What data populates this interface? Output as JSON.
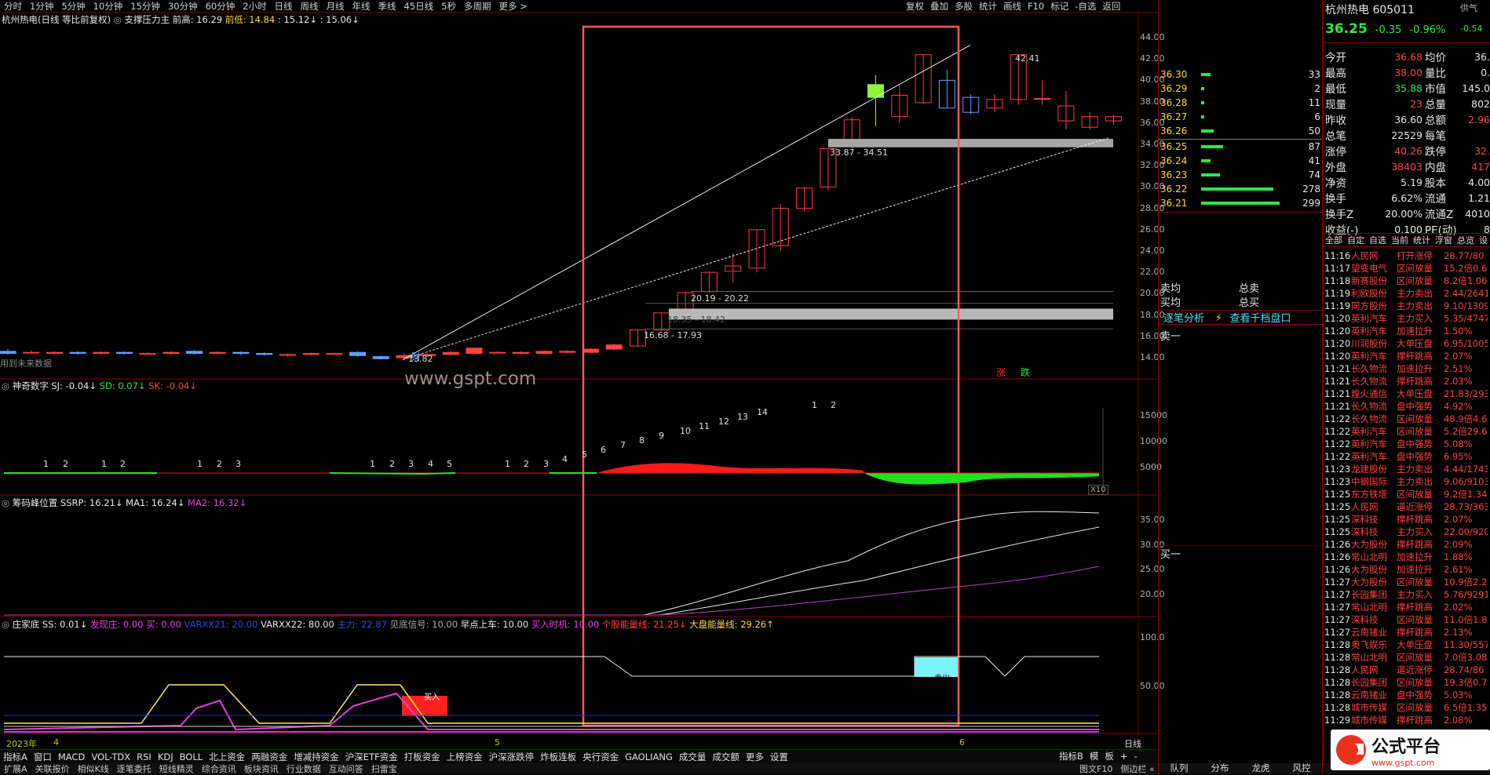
{
  "periods": [
    "分时",
    "1分钟",
    "5分钟",
    "10分钟",
    "15分钟",
    "30分钟",
    "60分钟",
    "2小时",
    "日线",
    "周线",
    "月线",
    "年线",
    "季线",
    "45日线",
    "5秒",
    "多周期",
    "更多 >"
  ],
  "tools": [
    "复权",
    "叠加",
    "多股",
    "统计",
    "画线",
    "F10",
    "标记",
    "-自选",
    "返回"
  ],
  "main_title": {
    "name": "杭州热电(日线 等比前复权)",
    "indicator": "支撑压力主",
    "pre_high_label": "前高: 16.29",
    "pre_low_label": "前低: 14.84",
    "v3": ": 15.12↓",
    "v4": ": 15.06↓"
  },
  "no_data": "用到未来数据",
  "price_axis": [
    "44.00",
    "42.00",
    "40.00",
    "38.00",
    "36.00",
    "34.00",
    "32.00",
    "30.00",
    "28.00",
    "26.00",
    "24.00",
    "22.00",
    "20.00",
    "18.00",
    "16.00",
    "14.00"
  ],
  "annotations": {
    "low": "13.82",
    "high": "42.41",
    "z1": "33.87 - 34.51",
    "z2": "20.19 - 20.22",
    "z3": "18.35 - 18.42",
    "z4": "16.68 - 17.93",
    "cai": "财",
    "zhang": "涨",
    "die": "跌"
  },
  "watermark": "www.gspt.com",
  "p2": {
    "title": "神奇数字",
    "sj": "SJ: -0.04↓",
    "sd": "SD: 0.07↓",
    "sk": "SK: -0.04↓",
    "axis": [
      "15000",
      "10000",
      "5000"
    ],
    "x10": "X10",
    "nums": [
      {
        "t": "1",
        "x": 55
      },
      {
        "t": "2",
        "x": 80
      },
      {
        "t": "1",
        "x": 129
      },
      {
        "t": "2",
        "x": 153
      },
      {
        "t": "1",
        "x": 251
      },
      {
        "t": "2",
        "x": 276
      },
      {
        "t": "3",
        "x": 300
      },
      {
        "t": "1",
        "x": 471
      },
      {
        "t": "2",
        "x": 496
      },
      {
        "t": "3",
        "x": 520
      },
      {
        "t": "4",
        "x": 545
      },
      {
        "t": "5",
        "x": 569
      },
      {
        "t": "1",
        "x": 643
      },
      {
        "t": "2",
        "x": 667
      },
      {
        "t": "3",
        "x": 692
      },
      {
        "t": "4",
        "x": 716
      },
      {
        "t": "5",
        "x": 741
      },
      {
        "t": "6",
        "x": 765
      },
      {
        "t": "7",
        "x": 790
      },
      {
        "t": "8",
        "x": 814
      },
      {
        "t": "9",
        "x": 839
      },
      {
        "t": "10",
        "x": 866
      },
      {
        "t": "11",
        "x": 890
      },
      {
        "t": "12",
        "x": 915
      },
      {
        "t": "13",
        "x": 939
      },
      {
        "t": "14",
        "x": 964
      },
      {
        "t": "1",
        "x": 1034
      },
      {
        "t": "2",
        "x": 1058
      }
    ]
  },
  "p3": {
    "title": "筹码峰位置",
    "ssrp": "SSRP: 16.21↓",
    "ma1": "MA1: 16.24↓",
    "ma2": "MA2: 16.32↓",
    "axis": [
      "35.00",
      "30.00",
      "25.00",
      "20.00"
    ]
  },
  "p4": {
    "title": "庄家底",
    "ss": "SS: 0.01↓",
    "fx": "发现庄: 0.00",
    "buy": "买: 0.00",
    "v21": "VARXX21: 20.00",
    "v22": "VARXX22: 80.00",
    "zl": "主力: 22.87",
    "jd": "见底信号: 10.00",
    "zd": "早点上车: 10.00",
    "ms": "买入时机: 10.00",
    "gg": "个股能量线: 21.25↓",
    "dp": "大盘能量线: 29.26↑",
    "axis": [
      "100.0",
      "50.00"
    ],
    "buy_tag": "买入",
    "sell_tag": "卖出"
  },
  "xaxis": {
    "y": "2023年",
    "m4": "4",
    "m5": "5",
    "m6": "6",
    "period": "日线"
  },
  "bottom_tabs": [
    "指标A",
    "窗口",
    "MACD",
    "VOL-TDX",
    "RSI",
    "KDJ",
    "BOLL",
    "北上资金",
    "两融资金",
    "增减持资金",
    "沪深ETF资金",
    "打板资金",
    "上榜资金",
    "沪深涨跌停",
    "炸板连板",
    "央行资金",
    "GAOLIANG",
    "成交量",
    "成交额",
    "更多",
    "设置"
  ],
  "bottom_right": [
    "指标B",
    "模",
    "板",
    "+",
    "-"
  ],
  "bottom2": [
    "扩展A",
    "关联报价",
    "相似K线",
    "逐笔委托",
    "短线精灵",
    "综合资讯",
    "板块资讯",
    "行业数据",
    "互动问答",
    "扫雷宝"
  ],
  "bottom2_right": [
    "图文F10",
    "侧边栏 «"
  ],
  "orderbook": {
    "sell": [
      {
        "p": "36.30",
        "v": "33",
        "w": 3
      },
      {
        "p": "36.29",
        "v": "2",
        "w": 1
      },
      {
        "p": "36.28",
        "v": "11",
        "w": 1
      },
      {
        "p": "36.27",
        "v": "6",
        "w": 1
      },
      {
        "p": "36.26",
        "v": "50",
        "w": 4
      }
    ],
    "buy": [
      {
        "p": "36.25",
        "v": "87",
        "w": 7
      },
      {
        "p": "36.24",
        "v": "41",
        "w": 3
      },
      {
        "p": "36.23",
        "v": "74",
        "w": 6
      },
      {
        "p": "36.22",
        "v": "278",
        "w": 23
      },
      {
        "p": "36.21",
        "v": "299",
        "w": 25
      }
    ],
    "mw": "卖均",
    "bw": "买均",
    "ms": "总卖",
    "bs": "总买",
    "detail": "逐笔分析",
    "thousand": "查看千档盘口",
    "sell1": "卖一",
    "buy1": "买一"
  },
  "quote": {
    "name": "杭州热电",
    "code": "605011",
    "price": "36.25",
    "chg": "-0.35",
    "pct": "-0.96%",
    "supply": "供气",
    "supply_pct": "-0.54",
    "rows": [
      [
        "今开",
        "36.68",
        "均价",
        "36."
      ],
      [
        "最高",
        "38.00",
        "量比",
        "0."
      ],
      [
        "最低",
        "35.88",
        "市值",
        "145.0"
      ],
      [
        "现量",
        "23",
        "总量",
        "802"
      ],
      [
        "昨收",
        "36.60",
        "总额",
        "2.96"
      ],
      [
        "总笔",
        "22529",
        "每笔",
        ""
      ],
      [
        "涨停",
        "40.26",
        "跌停",
        "32."
      ],
      [
        "外盘",
        "38403",
        "内盘",
        "417"
      ],
      [
        "净资",
        "5.19",
        "股本",
        "4.00"
      ],
      [
        "换手",
        "6.62%",
        "流通",
        "1.21"
      ],
      [
        "换手Z",
        "20.00%",
        "流通Z",
        "4010"
      ],
      [
        "收益(-)",
        "0.100",
        "PE(动)",
        "8"
      ]
    ],
    "tabs": [
      "全部",
      "自定",
      "自选",
      "当前",
      "统计",
      "浮窗",
      "总览",
      "设"
    ]
  },
  "feed": [
    [
      "11:16",
      "人民网",
      "打开涨停",
      "28.77/80"
    ],
    [
      "11:17",
      "望变电气",
      "区间放量",
      "15.2倍0.66"
    ],
    [
      "11:18",
      "新赛股份",
      "区间放量",
      "8.2倍1.06%"
    ],
    [
      "11:19",
      "利欧股份",
      "主力卖出",
      "2.44/2641"
    ],
    [
      "11:19",
      "同方股份",
      "主力卖出",
      "9.10/1309"
    ],
    [
      "11:20",
      "英利汽车",
      "主力买入",
      "5.35/4747"
    ],
    [
      "11:20",
      "英利汽车",
      "加速拉升",
      "1.50%"
    ],
    [
      "11:20",
      "川润股份",
      "大单压盘",
      "6.95/1005"
    ],
    [
      "11:20",
      "英利汽车",
      "撑杆跳高",
      "2.07%"
    ],
    [
      "11:21",
      "长久物流",
      "加速拉升",
      "2.51%"
    ],
    [
      "11:21",
      "长久物流",
      "撑杆跳高",
      "2.03%"
    ],
    [
      "11:21",
      "煌火通信",
      "大单压盘",
      "21.83/293"
    ],
    [
      "11:21",
      "长久物流",
      "盘中强势",
      "4.92%"
    ],
    [
      "11:22",
      "长久物流",
      "区间放量",
      "48.9倍4.61"
    ],
    [
      "11:22",
      "英利汽车",
      "区间放量",
      "5.2倍29.6"
    ],
    [
      "11:22",
      "英利汽车",
      "盘中强势",
      "5.08%"
    ],
    [
      "11:22",
      "英利汽车",
      "盘中强势",
      "6.95%"
    ],
    [
      "11:23",
      "龙建股份",
      "主力卖出",
      "4.44/1743"
    ],
    [
      "11:23",
      "中钢国际",
      "主力卖出",
      "9.06/9103"
    ],
    [
      "11:25",
      "东方铁塔",
      "区间放量",
      "9.2倍1.34"
    ],
    [
      "11:25",
      "人民网",
      "逼近涨停",
      "28.73/363"
    ],
    [
      "11:25",
      "深科技",
      "撑杆跳高",
      "2.07%"
    ],
    [
      "11:25",
      "深科技",
      "主力买入",
      "22.00/920"
    ],
    [
      "11:26",
      "大为股份",
      "撑杆跳高",
      "2.09%"
    ],
    [
      "11:26",
      "常山北明",
      "加速拉升",
      "1.88%"
    ],
    [
      "11:26",
      "大为股份",
      "加速拉升",
      "2.61%"
    ],
    [
      "11:27",
      "大为股份",
      "区间放量",
      "10.9倍2.2"
    ],
    [
      "11:27",
      "长园集团",
      "主力买入",
      "5.76/9291"
    ],
    [
      "11:27",
      "常山北明",
      "撑杆跳高",
      "2.02%"
    ],
    [
      "11:27",
      "深科技",
      "区间放量",
      "11.0倍1.8"
    ],
    [
      "11:27",
      "云南锗业",
      "撑杆跳高",
      "2.13%"
    ],
    [
      "11:28",
      "奥飞娱乐",
      "大单压盘",
      "11.30/557"
    ],
    [
      "11:28",
      "常山北明",
      "区间放量",
      "7.0倍3.08"
    ],
    [
      "11:28",
      "人民网",
      "逼近涨停",
      "28.74/86"
    ],
    [
      "11:28",
      "长园集团",
      "区间放量",
      "19.3倍0.73"
    ],
    [
      "11:28",
      "云南锗业",
      "盘中强势",
      "5.03%"
    ],
    [
      "11:28",
      "城市传媒",
      "区间放量",
      "6.5倍1.35"
    ],
    [
      "11:29",
      "城市传媒",
      "撑杆跳高",
      "2.08%"
    ]
  ],
  "logo": {
    "name": "公式平台",
    "url": "www.gspt.com"
  },
  "bottom3": [
    "队列",
    "分布",
    "龙虎",
    "风控"
  ],
  "chart_data": {
    "type": "candlestick",
    "series": [
      {
        "name": "price",
        "values": [
          {
            "o": 14.6,
            "c": 14.4,
            "h": 14.8,
            "l": 14.3
          },
          {
            "o": 14.5,
            "c": 14.5,
            "h": 14.7,
            "l": 14.4
          },
          {
            "o": 14.4,
            "c": 14.5,
            "h": 14.6,
            "l": 14.3
          },
          {
            "o": 14.5,
            "c": 14.4,
            "h": 14.6,
            "l": 14.3
          },
          {
            "o": 14.4,
            "c": 14.5,
            "h": 14.6,
            "l": 14.3
          },
          {
            "o": 14.5,
            "c": 14.4,
            "h": 14.6,
            "l": 14.3
          },
          {
            "o": 14.4,
            "c": 14.4,
            "h": 14.5,
            "l": 14.3
          },
          {
            "o": 14.4,
            "c": 14.5,
            "h": 14.6,
            "l": 14.3
          },
          {
            "o": 14.6,
            "c": 14.4,
            "h": 14.7,
            "l": 14.3
          },
          {
            "o": 14.4,
            "c": 14.5,
            "h": 14.6,
            "l": 14.3
          },
          {
            "o": 14.5,
            "c": 14.4,
            "h": 14.6,
            "l": 14.2
          },
          {
            "o": 14.4,
            "c": 14.3,
            "h": 14.5,
            "l": 14.2
          },
          {
            "o": 14.3,
            "c": 14.3,
            "h": 14.4,
            "l": 14.1
          },
          {
            "o": 14.3,
            "c": 14.4,
            "h": 14.5,
            "l": 14.2
          },
          {
            "o": 14.4,
            "c": 14.4,
            "h": 14.5,
            "l": 14.3
          },
          {
            "o": 14.5,
            "c": 14.2,
            "h": 14.6,
            "l": 14.1
          },
          {
            "o": 14.1,
            "c": 13.9,
            "h": 14.2,
            "l": 13.82
          },
          {
            "o": 14.0,
            "c": 14.2,
            "h": 14.4,
            "l": 13.9
          },
          {
            "o": 14.2,
            "c": 14.3,
            "h": 14.4,
            "l": 14.1
          },
          {
            "o": 14.3,
            "c": 14.5,
            "h": 14.6,
            "l": 14.2
          },
          {
            "o": 14.4,
            "c": 14.9,
            "h": 14.9,
            "l": 14.3
          },
          {
            "o": 14.5,
            "c": 14.5,
            "h": 14.6,
            "l": 14.4
          },
          {
            "o": 14.4,
            "c": 14.5,
            "h": 14.6,
            "l": 14.3
          },
          {
            "o": 14.4,
            "c": 14.6,
            "h": 14.7,
            "l": 14.3
          },
          {
            "o": 14.5,
            "c": 14.6,
            "h": 14.7,
            "l": 14.4
          },
          {
            "o": 14.5,
            "c": 14.8,
            "h": 14.9,
            "l": 14.4
          },
          {
            "o": 14.8,
            "c": 15.2,
            "h": 15.3,
            "l": 14.7
          },
          {
            "o": 15.1,
            "c": 16.6,
            "h": 16.6,
            "l": 15.0
          },
          {
            "o": 16.6,
            "c": 18.2,
            "h": 18.2,
            "l": 16.5
          },
          {
            "o": 18.3,
            "c": 20.1,
            "h": 20.2,
            "l": 18.2
          },
          {
            "o": 20.2,
            "c": 22.0,
            "h": 22.1,
            "l": 20.1
          },
          {
            "o": 22.1,
            "c": 22.6,
            "h": 23.8,
            "l": 21.0
          },
          {
            "o": 22.4,
            "c": 26.0,
            "h": 26.0,
            "l": 22.0
          },
          {
            "o": 24.5,
            "c": 28.0,
            "h": 28.4,
            "l": 24.0
          },
          {
            "o": 28.0,
            "c": 29.9,
            "h": 30.0,
            "l": 27.7
          },
          {
            "o": 30.0,
            "c": 33.6,
            "h": 33.6,
            "l": 29.7
          },
          {
            "o": 33.8,
            "c": 36.3,
            "h": 36.6,
            "l": 33.6
          },
          {
            "o": 39.6,
            "c": 38.4,
            "h": 40.5,
            "l": 35.7
          },
          {
            "o": 36.6,
            "c": 38.6,
            "h": 39.6,
            "l": 36.0
          },
          {
            "o": 37.9,
            "c": 42.4,
            "h": 42.4,
            "l": 37.8
          },
          {
            "o": 40.0,
            "c": 37.4,
            "h": 41.0,
            "l": 37.4
          },
          {
            "o": 38.4,
            "c": 37.0,
            "h": 38.7,
            "l": 36.8
          },
          {
            "o": 37.4,
            "c": 38.2,
            "h": 38.7,
            "l": 37.0
          },
          {
            "o": 38.2,
            "c": 42.4,
            "h": 42.41,
            "l": 37.7
          },
          {
            "o": 38.3,
            "c": 38.3,
            "h": 40.0,
            "l": 37.7
          },
          {
            "o": 36.2,
            "c": 37.6,
            "h": 39.0,
            "l": 35.4
          },
          {
            "o": 35.6,
            "c": 36.6,
            "h": 37.0,
            "l": 35.4
          },
          {
            "o": 36.2,
            "c": 36.6,
            "h": 36.8,
            "l": 35.8
          }
        ]
      }
    ]
  }
}
